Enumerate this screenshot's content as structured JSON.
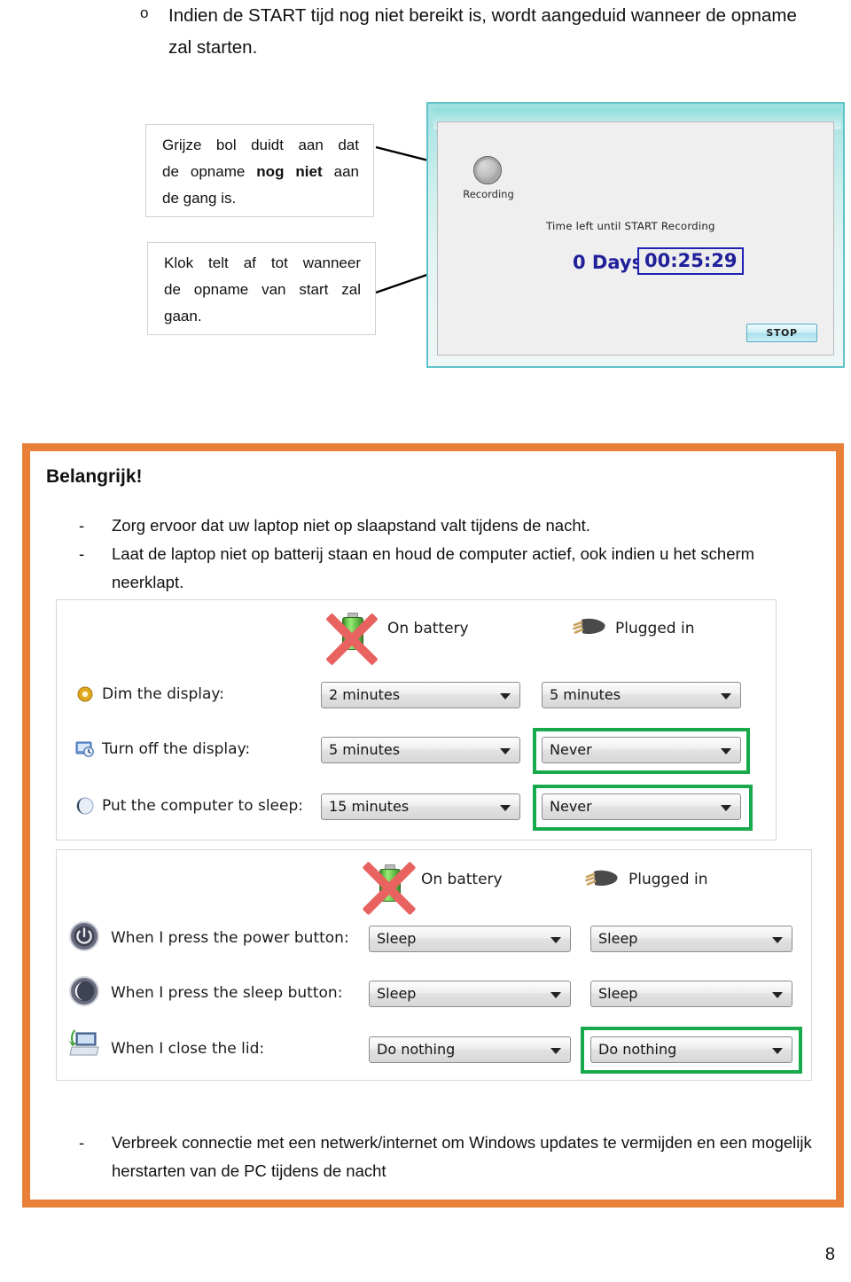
{
  "top_bullet": {
    "marker": "o",
    "text": "Indien de START tijd nog niet bereikt is, wordt aangeduid wanneer de opname zal starten."
  },
  "callouts": [
    {
      "name": "grey-ball-callout",
      "line1": "Grijze bol duidt aan dat",
      "line2_pre": "de opname ",
      "line2_bold": "nog niet",
      "line2_post": " aan",
      "line3": "de gang is."
    },
    {
      "name": "clock-callout",
      "line1": "Klok telt af tot wanneer",
      "line2": "de opname van start zal",
      "line3": "gaan."
    }
  ],
  "recording_window": {
    "led_label": "Recording",
    "subtitle": "Time left until START Recording",
    "days": "0 Days",
    "clock": "00:25:29",
    "stop_button": "STOP"
  },
  "important_block": {
    "heading": "Belangrijk!",
    "bullets": [
      {
        "dash": "-",
        "text": "Zorg ervoor dat uw laptop niet op slaapstand valt tijdens de nacht."
      },
      {
        "dash": "-",
        "text": "Laat de laptop niet op batterij staan en houd de computer actief, ook indien u het scherm neerklapt."
      },
      {
        "dash": "-",
        "text": "Verbreek connectie met een netwerk/internet om Windows updates te vermijden en een mogelijk herstarten van de PC tijdens de nacht"
      }
    ]
  },
  "power_panel_top": {
    "columns": [
      {
        "icon": "battery-icon",
        "label": "On battery",
        "crossed_out": true
      },
      {
        "icon": "power-plug-icon",
        "label": "Plugged in",
        "crossed_out": false
      }
    ],
    "rows": [
      {
        "icon": "brightness-icon",
        "label": "Dim the display:",
        "on_battery": "2 minutes",
        "plugged_in": "5 minutes",
        "highlight_plugged": false
      },
      {
        "icon": "monitor-clock-icon",
        "label": "Turn off the display:",
        "on_battery": "5 minutes",
        "plugged_in": "Never",
        "highlight_plugged": true
      },
      {
        "icon": "sleep-moon-icon",
        "label": "Put the computer to sleep:",
        "on_battery": "15 minutes",
        "plugged_in": "Never",
        "highlight_plugged": true
      }
    ]
  },
  "power_panel_bottom": {
    "columns": [
      {
        "icon": "battery-icon",
        "label": "On battery",
        "crossed_out": true
      },
      {
        "icon": "power-plug-icon",
        "label": "Plugged in",
        "crossed_out": false
      }
    ],
    "rows": [
      {
        "icon": "power-button-icon",
        "label": "When I press the power button:",
        "on_battery": "Sleep",
        "plugged_in": "Sleep",
        "highlight_plugged": false
      },
      {
        "icon": "sleep-button-icon",
        "label": "When I press the sleep button:",
        "on_battery": "Sleep",
        "plugged_in": "Sleep",
        "highlight_plugged": false
      },
      {
        "icon": "close-lid-icon",
        "label": "When I close the lid:",
        "on_battery": "Do nothing",
        "plugged_in": "Do nothing",
        "highlight_plugged": true
      }
    ]
  },
  "page_number": "8",
  "colors": {
    "frame_orange": "#e8803a",
    "highlight_green": "#17a94c",
    "cross_red": "#e8635f",
    "clock_blue": "#20209a",
    "window_teal": "#5fc4c8"
  }
}
